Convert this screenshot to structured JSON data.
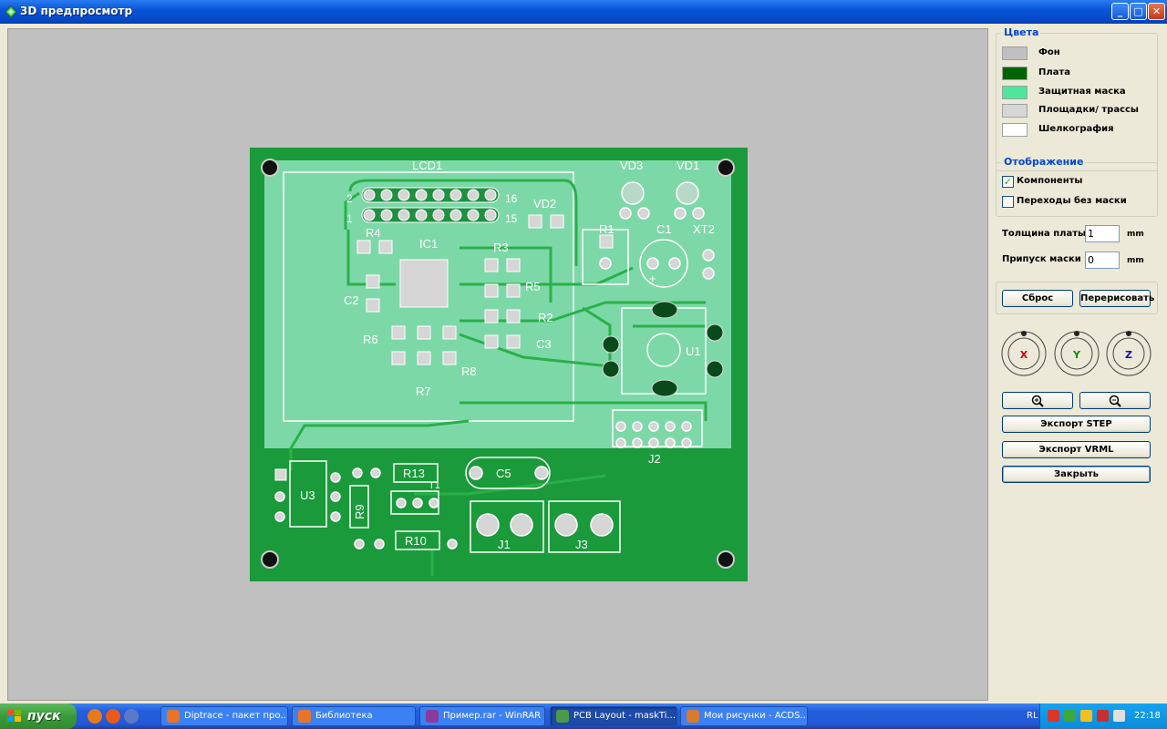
{
  "window": {
    "title": "3D предпросмотр"
  },
  "window_buttons": {
    "minimize": "_",
    "maximize": "□",
    "close": "✕"
  },
  "pcb_labels": {
    "lcd1": "LCD1",
    "vd3": "VD3",
    "vd1": "VD1",
    "vd2": "VD2",
    "r1": "R1",
    "c1": "C1",
    "xt2": "XT2",
    "r4": "R4",
    "ic1": "IC1",
    "r3": "R3",
    "c2": "C2",
    "r5": "R5",
    "r2": "R2",
    "r6": "R6",
    "c3": "C3",
    "r8": "R8",
    "r7": "R7",
    "u1": "U1",
    "j2": "J2",
    "r13": "R13",
    "t1": "T1",
    "c5": "C5",
    "u3": "U3",
    "r9": "R9",
    "r10": "R10",
    "j1": "J1",
    "j3": "J3",
    "pin2": "2",
    "pin16": "16",
    "pin1": "1",
    "pin15": "15",
    "plus": "+"
  },
  "colors_group": {
    "title": "Цвета",
    "items": [
      {
        "label": "Фон",
        "color": "#c0c0c0"
      },
      {
        "label": "Плата",
        "color": "#006400"
      },
      {
        "label": "Защитная маска",
        "color": "#4ee69a"
      },
      {
        "label": "Площадки/ трассы",
        "color": "#d6d6d6"
      },
      {
        "label": "Шелкография",
        "color": "#ffffff"
      }
    ]
  },
  "display_group": {
    "title": "Отображение",
    "components": {
      "label": "Компоненты",
      "checked": true
    },
    "vias": {
      "label": "Переходы без маски",
      "checked": false
    }
  },
  "board_thickness": {
    "label": "Толщина платы",
    "value": "1",
    "unit": "mm"
  },
  "mask_margin": {
    "label": "Припуск маски",
    "value": "0",
    "unit": "mm"
  },
  "buttons": {
    "reset": "Сброс",
    "redraw": "Перерисовать",
    "zoom_in": "zoom-in-icon",
    "zoom_out": "zoom-out-icon",
    "export_step": "Экспорт STEP",
    "export_vrml": "Экспорт VRML",
    "close": "Закрыть"
  },
  "rotation": {
    "x": "X",
    "y": "Y",
    "z": "Z"
  },
  "taskbar": {
    "start": "пуск",
    "tasks": [
      {
        "label": "Diptrace - пакет про...",
        "icon_color": "#e8742a"
      },
      {
        "label": "Библиотека",
        "icon_color": "#e8742a"
      },
      {
        "label": "Пример.rar - WinRAR",
        "icon_color": "#8a3a9a"
      },
      {
        "label": "PCB Layout - maskTi...",
        "icon_color": "#4a9a4a"
      },
      {
        "label": "Мои рисунки - ACDS...",
        "icon_color": "#d87a30"
      }
    ],
    "language": "RL",
    "clock": "22:18"
  }
}
